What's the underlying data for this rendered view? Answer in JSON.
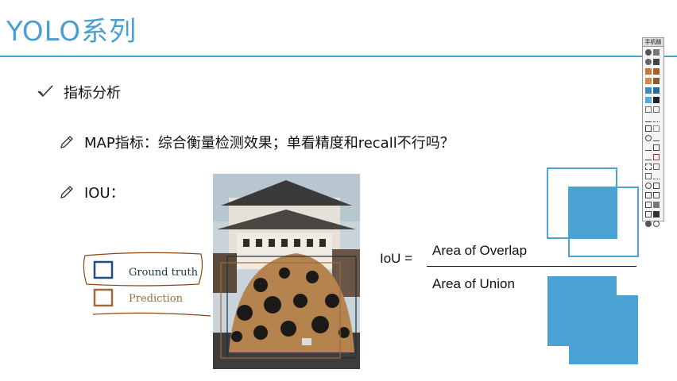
{
  "title": "YOLO系列",
  "bullets": {
    "b1": "指标分析",
    "b2": "MAP指标：综合衡量检测效果；单看精度和recall不行吗？",
    "b3": "IOU："
  },
  "legend": {
    "ground_truth": "Ground truth",
    "prediction": "Prediction"
  },
  "formula": {
    "lhs": "IoU =",
    "numerator": "Area of Overlap",
    "denominator": "Area of Union"
  },
  "toolbar": {
    "head": "手机版"
  },
  "colors": {
    "accent": "#4a9fd0",
    "overlap_fill": "#4aa3d2",
    "gt_box": "#1f4e79",
    "pred_box": "#9c6b3c",
    "handwrite": "#8b4513"
  }
}
